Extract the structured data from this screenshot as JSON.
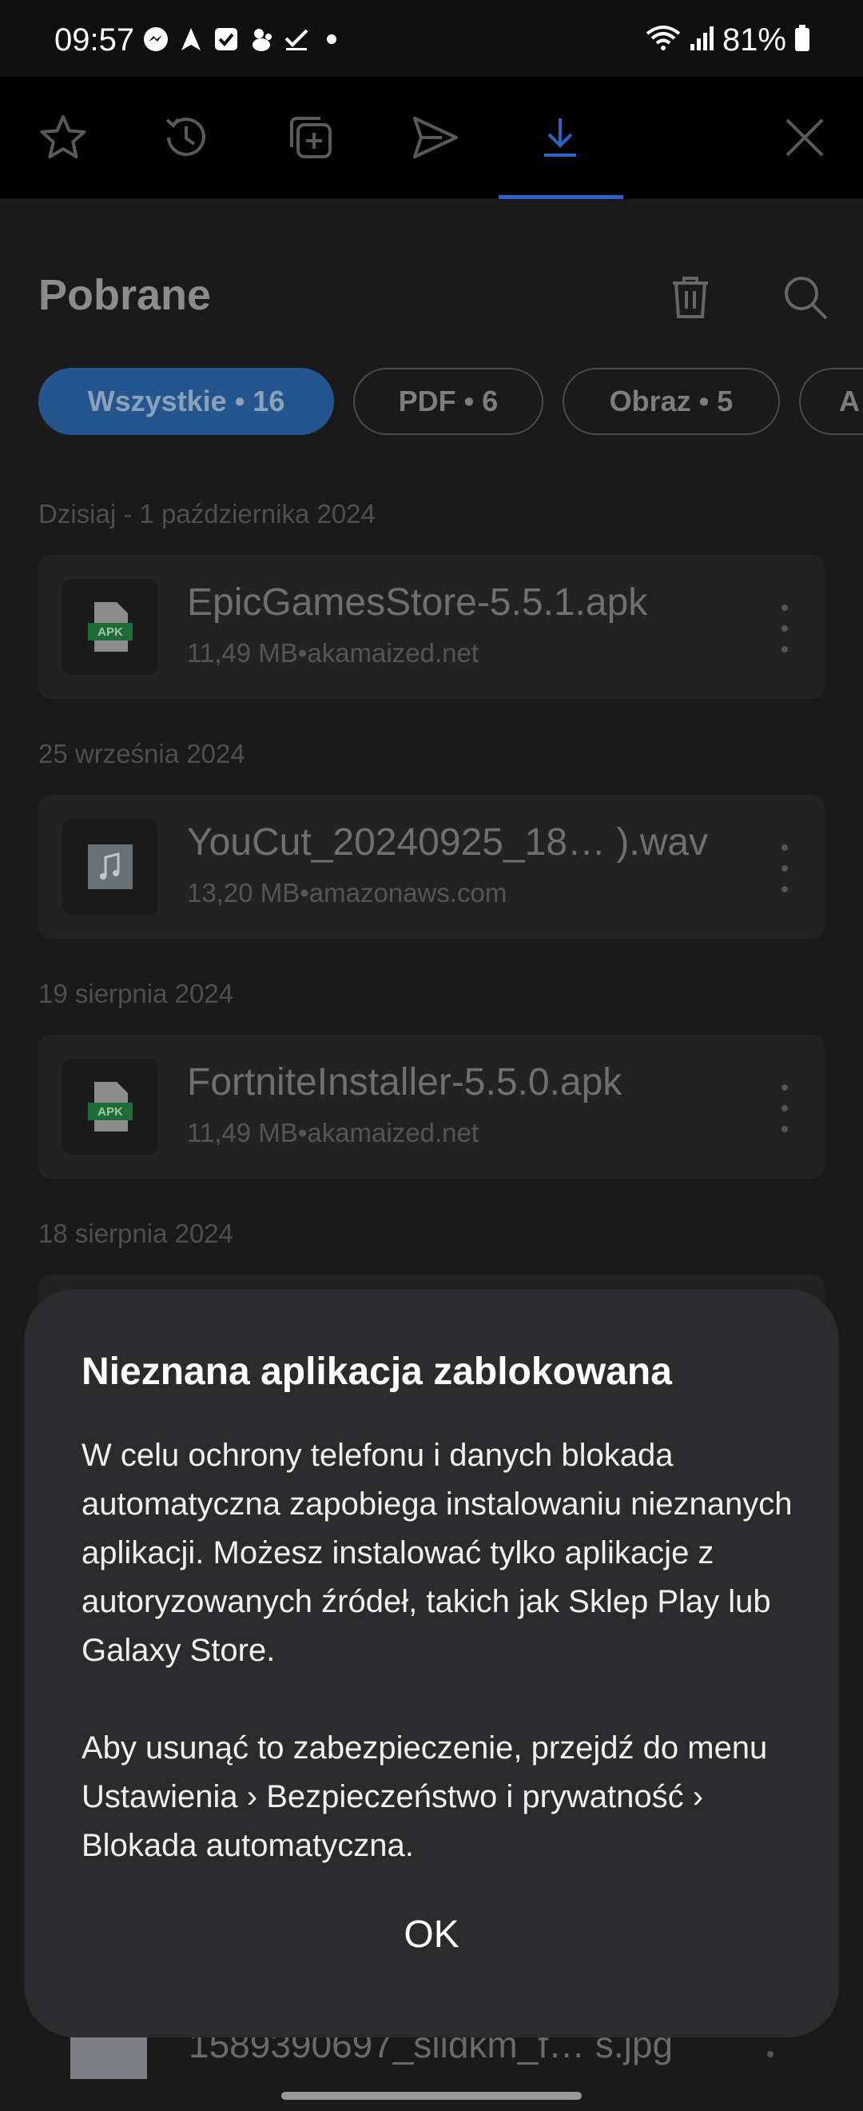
{
  "status_bar": {
    "time": "09:57",
    "battery": "81%",
    "notification_icons": [
      "messenger-icon",
      "navigation-icon",
      "checkbox-icon",
      "squirrel-icon",
      "checkmark-icon",
      "dot-icon"
    ],
    "system_icons": [
      "wifi-icon",
      "signal-icon",
      "battery-icon"
    ]
  },
  "tabs": [
    {
      "name": "bookmarks",
      "icon": "star-icon"
    },
    {
      "name": "history",
      "icon": "history-icon"
    },
    {
      "name": "saved-pages",
      "icon": "add-page-icon"
    },
    {
      "name": "share",
      "icon": "send-icon"
    },
    {
      "name": "downloads",
      "icon": "download-icon",
      "active": true
    }
  ],
  "header": {
    "title": "Pobrane"
  },
  "filters": [
    {
      "label": "Wszystkie • 16",
      "active": true
    },
    {
      "label": "PDF • 6",
      "active": false
    },
    {
      "label": "Obraz • 5",
      "active": false
    },
    {
      "label": "A",
      "active": false
    }
  ],
  "groups": [
    {
      "date": "Dzisiaj - 1 października 2024",
      "item": {
        "name": "EpicGamesStore-5.5.1.apk",
        "meta": "11,49 MB•akamaized.net",
        "type": "apk",
        "badge": "APK"
      }
    },
    {
      "date": "25 września 2024",
      "item": {
        "name": "YouCut_20240925_18… ).wav",
        "meta": "13,20 MB•amazonaws.com",
        "type": "audio"
      }
    },
    {
      "date": "19 sierpnia 2024",
      "item": {
        "name": "FortniteInstaller-5.5.0.apk",
        "meta": "11,49 MB•akamaized.net",
        "type": "apk",
        "badge": "APK"
      }
    },
    {
      "date": "18 sierpnia 2024"
    }
  ],
  "peek_item": {
    "name": "1589390697_slidkm_f…  s.jpg"
  },
  "dialog": {
    "title": "Nieznana aplikacja zablokowana",
    "paragraph1": "W celu ochrony telefonu i danych blokada automatyczna zapobiega instalowaniu nieznanych aplikacji. Możesz instalować tylko aplikacje z autoryzowanych źródeł, takich jak Sklep Play lub Galaxy Store.",
    "paragraph2": "Aby usunąć to zabezpieczenie, przejdź do menu Ustawienia › Bezpieczeństwo i prywatność › Blokada automatyczna.",
    "ok_label": "OK"
  },
  "colors": {
    "accent": "#25558e",
    "tab_active": "#2b63c7",
    "dialog_bg": "#2b2b2d"
  }
}
